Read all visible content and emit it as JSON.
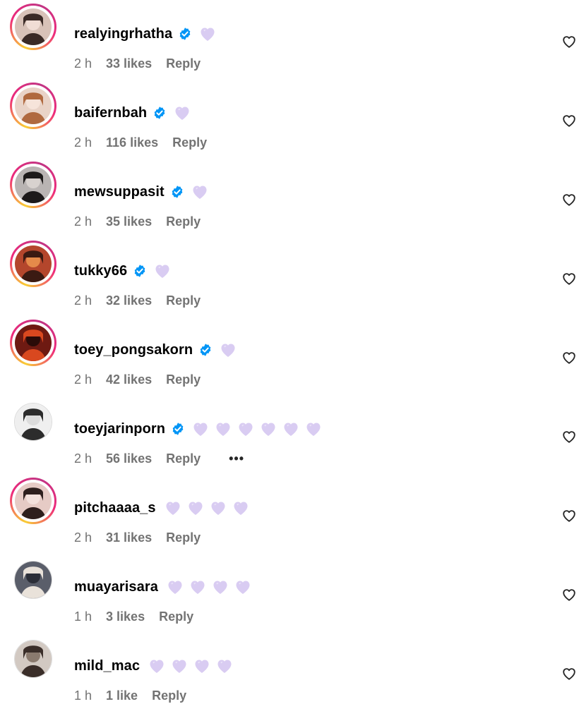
{
  "comments": [
    {
      "username": "realyingrhatha",
      "verified": true,
      "emoji_count": 1,
      "time": "2 h",
      "likes": "33 likes",
      "reply": "Reply",
      "story_ring": true,
      "avatar_icon": "avatar-photo",
      "avatar_colors": [
        "#d8c2b8",
        "#3a2a26",
        "#f0ddd5"
      ]
    },
    {
      "username": "baifernbah",
      "verified": true,
      "emoji_count": 1,
      "time": "2 h",
      "likes": "116 likes",
      "reply": "Reply",
      "story_ring": true,
      "avatar_icon": "avatar-photo",
      "avatar_colors": [
        "#e9d3c7",
        "#b0693f",
        "#f6e4da"
      ]
    },
    {
      "username": "mewsuppasit",
      "verified": true,
      "emoji_count": 1,
      "time": "2 h",
      "likes": "35 likes",
      "reply": "Reply",
      "story_ring": true,
      "avatar_icon": "avatar-photo",
      "avatar_colors": [
        "#b9b4b3",
        "#1d1a1a",
        "#d8d2cf"
      ]
    },
    {
      "username": "tukky66",
      "verified": true,
      "emoji_count": 1,
      "time": "2 h",
      "likes": "32 likes",
      "reply": "Reply",
      "story_ring": true,
      "avatar_icon": "avatar-photo",
      "avatar_colors": [
        "#b4462c",
        "#3b1a12",
        "#e58a4a"
      ]
    },
    {
      "username": "toey_pongsakorn",
      "verified": true,
      "emoji_count": 1,
      "time": "2 h",
      "likes": "42 likes",
      "reply": "Reply",
      "story_ring": true,
      "avatar_icon": "avatar-photo",
      "avatar_colors": [
        "#6e1a12",
        "#d9481f",
        "#2a0b08"
      ]
    },
    {
      "username": "toeyjarinporn",
      "verified": true,
      "emoji_count": 6,
      "time": "2 h",
      "likes": "56 likes",
      "reply": "Reply",
      "more": "•••",
      "story_ring": false,
      "avatar_icon": "avatar-photo",
      "avatar_colors": [
        "#efefef",
        "#2c2c2c",
        "#dcdcdc"
      ]
    },
    {
      "username": "pitchaaaa_s",
      "verified": false,
      "emoji_count": 4,
      "time": "2 h",
      "likes": "31 likes",
      "reply": "Reply",
      "story_ring": true,
      "avatar_icon": "avatar-photo",
      "avatar_colors": [
        "#e6cbc5",
        "#2e1f1d",
        "#f3e1dc"
      ]
    },
    {
      "username": "muayarisara",
      "verified": false,
      "emoji_count": 4,
      "time": "1 h",
      "likes": "3 likes",
      "reply": "Reply",
      "story_ring": false,
      "avatar_icon": "avatar-photo",
      "avatar_colors": [
        "#5a5e6a",
        "#e9e2da",
        "#2b2e38"
      ]
    },
    {
      "username": "mild_mac",
      "verified": false,
      "emoji_count": 4,
      "time": "1 h",
      "likes": "1 like",
      "reply": "Reply",
      "story_ring": false,
      "avatar_icon": "avatar-photo",
      "avatar_colors": [
        "#d2c9c2",
        "#3a2e29",
        "#8a7a6e"
      ]
    }
  ],
  "icons": {
    "verified": "verified-badge-icon",
    "emoji": "purple-heart-emoji",
    "like": "heart-outline-icon"
  },
  "colors": {
    "verified_blue": "#0095f6",
    "emoji_purple": "#d9ccf2",
    "secondary_text": "#737373"
  }
}
